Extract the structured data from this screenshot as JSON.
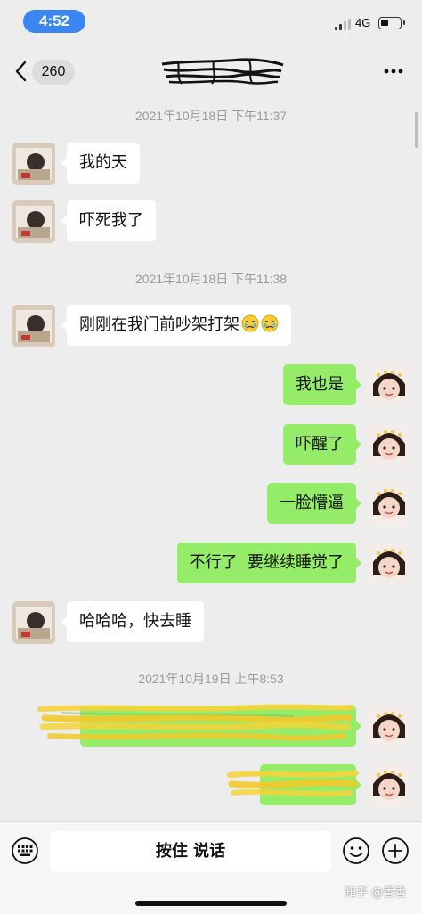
{
  "status_bar": {
    "time": "4:52",
    "network": "4G",
    "icons": [
      "signal-icon",
      "battery-icon"
    ]
  },
  "nav": {
    "back_icon": "chevron-left-icon",
    "unread_count": "260",
    "more_icon": "more-dots-icon"
  },
  "chat": {
    "timestamps": [
      "2021年10月18日 下午11:37",
      "2021年10月18日 下午11:38",
      "2021年10月19日 上午8:53"
    ],
    "messages": [
      {
        "side": "left",
        "text": "我的天"
      },
      {
        "side": "left",
        "text": "吓死我了"
      },
      {
        "side": "left",
        "text": "刚刚在我门前吵架打架",
        "emoji": [
          "crying-face-icon",
          "crying-face-icon"
        ]
      },
      {
        "side": "right",
        "text": "我也是"
      },
      {
        "side": "right",
        "text": "吓醒了"
      },
      {
        "side": "right",
        "text": "一脸懵逼"
      },
      {
        "side": "right",
        "text": "不行了  要继续睡觉了"
      },
      {
        "side": "left",
        "text": "哈哈哈，快去睡"
      },
      {
        "side": "right",
        "text": ""
      },
      {
        "side": "right",
        "text": ""
      }
    ]
  },
  "input_bar": {
    "hold_to_talk": "按住 说话",
    "icons": [
      "keyboard-icon",
      "emoji-icon",
      "plus-icon"
    ]
  },
  "watermark": "知乎 @香香",
  "colors": {
    "background": "#ededed",
    "self_bubble": "#95ec69",
    "other_bubble": "#ffffff",
    "time_pill": "#3b86f0",
    "scribble_black": "#111111",
    "scribble_yellow": "#f5d33a"
  }
}
